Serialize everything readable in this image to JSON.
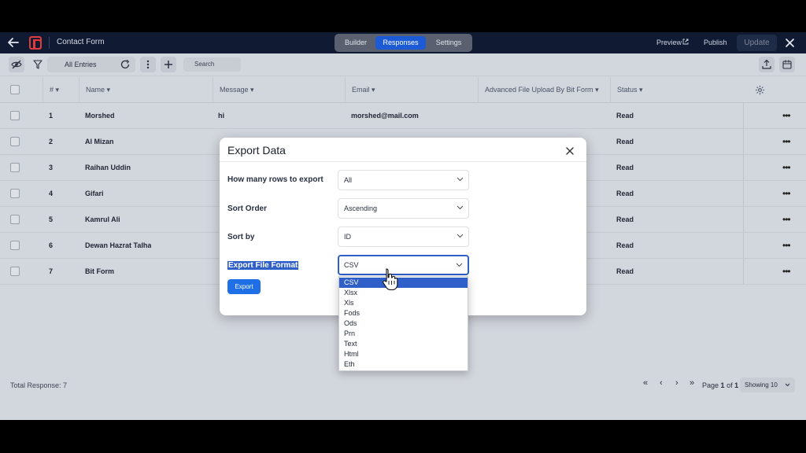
{
  "topbar": {
    "title": "Contact Form",
    "tabs": [
      {
        "label": "Builder"
      },
      {
        "label": "Responses"
      },
      {
        "label": "Settings"
      }
    ],
    "preview_label": "Preview",
    "publish_label": "Publish",
    "update_label": "Update",
    "active_tab_color": "#1d5ad6"
  },
  "toolbar": {
    "filter_label": "All Entries",
    "search_placeholder": "Search"
  },
  "table": {
    "columns": [
      "#",
      "Name",
      "Message",
      "Email",
      "Advanced File Upload By Bit Form",
      "Status"
    ],
    "rows": [
      {
        "num": "1",
        "name": "Morshed",
        "message": "hi",
        "email": "morshed@mail.com",
        "status": "Read"
      },
      {
        "num": "2",
        "name": "Al Mizan",
        "message": "",
        "email": "",
        "status": "Read"
      },
      {
        "num": "3",
        "name": "Raihan Uddin",
        "message": "",
        "email": "",
        "status": "Read"
      },
      {
        "num": "4",
        "name": "Gifari",
        "message": "",
        "email": "",
        "status": "Read"
      },
      {
        "num": "5",
        "name": "Kamrul Ali",
        "message": "",
        "email": "",
        "status": "Read"
      },
      {
        "num": "6",
        "name": "Dewan Hazrat Talha",
        "message": "",
        "email": "",
        "status": "Read"
      },
      {
        "num": "7",
        "name": "Bit Form",
        "message": "",
        "email": "",
        "status": "Read"
      }
    ]
  },
  "footer": {
    "total_label": "Total Response: 7",
    "page_prefix": "Page",
    "page_current": "1",
    "page_of": "of",
    "page_total": "1",
    "showing_label": "Showing 10"
  },
  "modal": {
    "title": "Export Data",
    "fields": [
      {
        "label": "How many rows to export",
        "value": "All"
      },
      {
        "label": "Sort Order",
        "value": "Ascending"
      },
      {
        "label": "Sort by",
        "value": "ID"
      },
      {
        "label": "Export File Format",
        "value": "CSV"
      }
    ],
    "export_label": "Export",
    "accent_color": "#2f5fc9"
  },
  "format_options": [
    "CSV",
    "Xlsx",
    "Xls",
    "Fods",
    "Ods",
    "Prn",
    "Text",
    "Html",
    "Eth"
  ]
}
